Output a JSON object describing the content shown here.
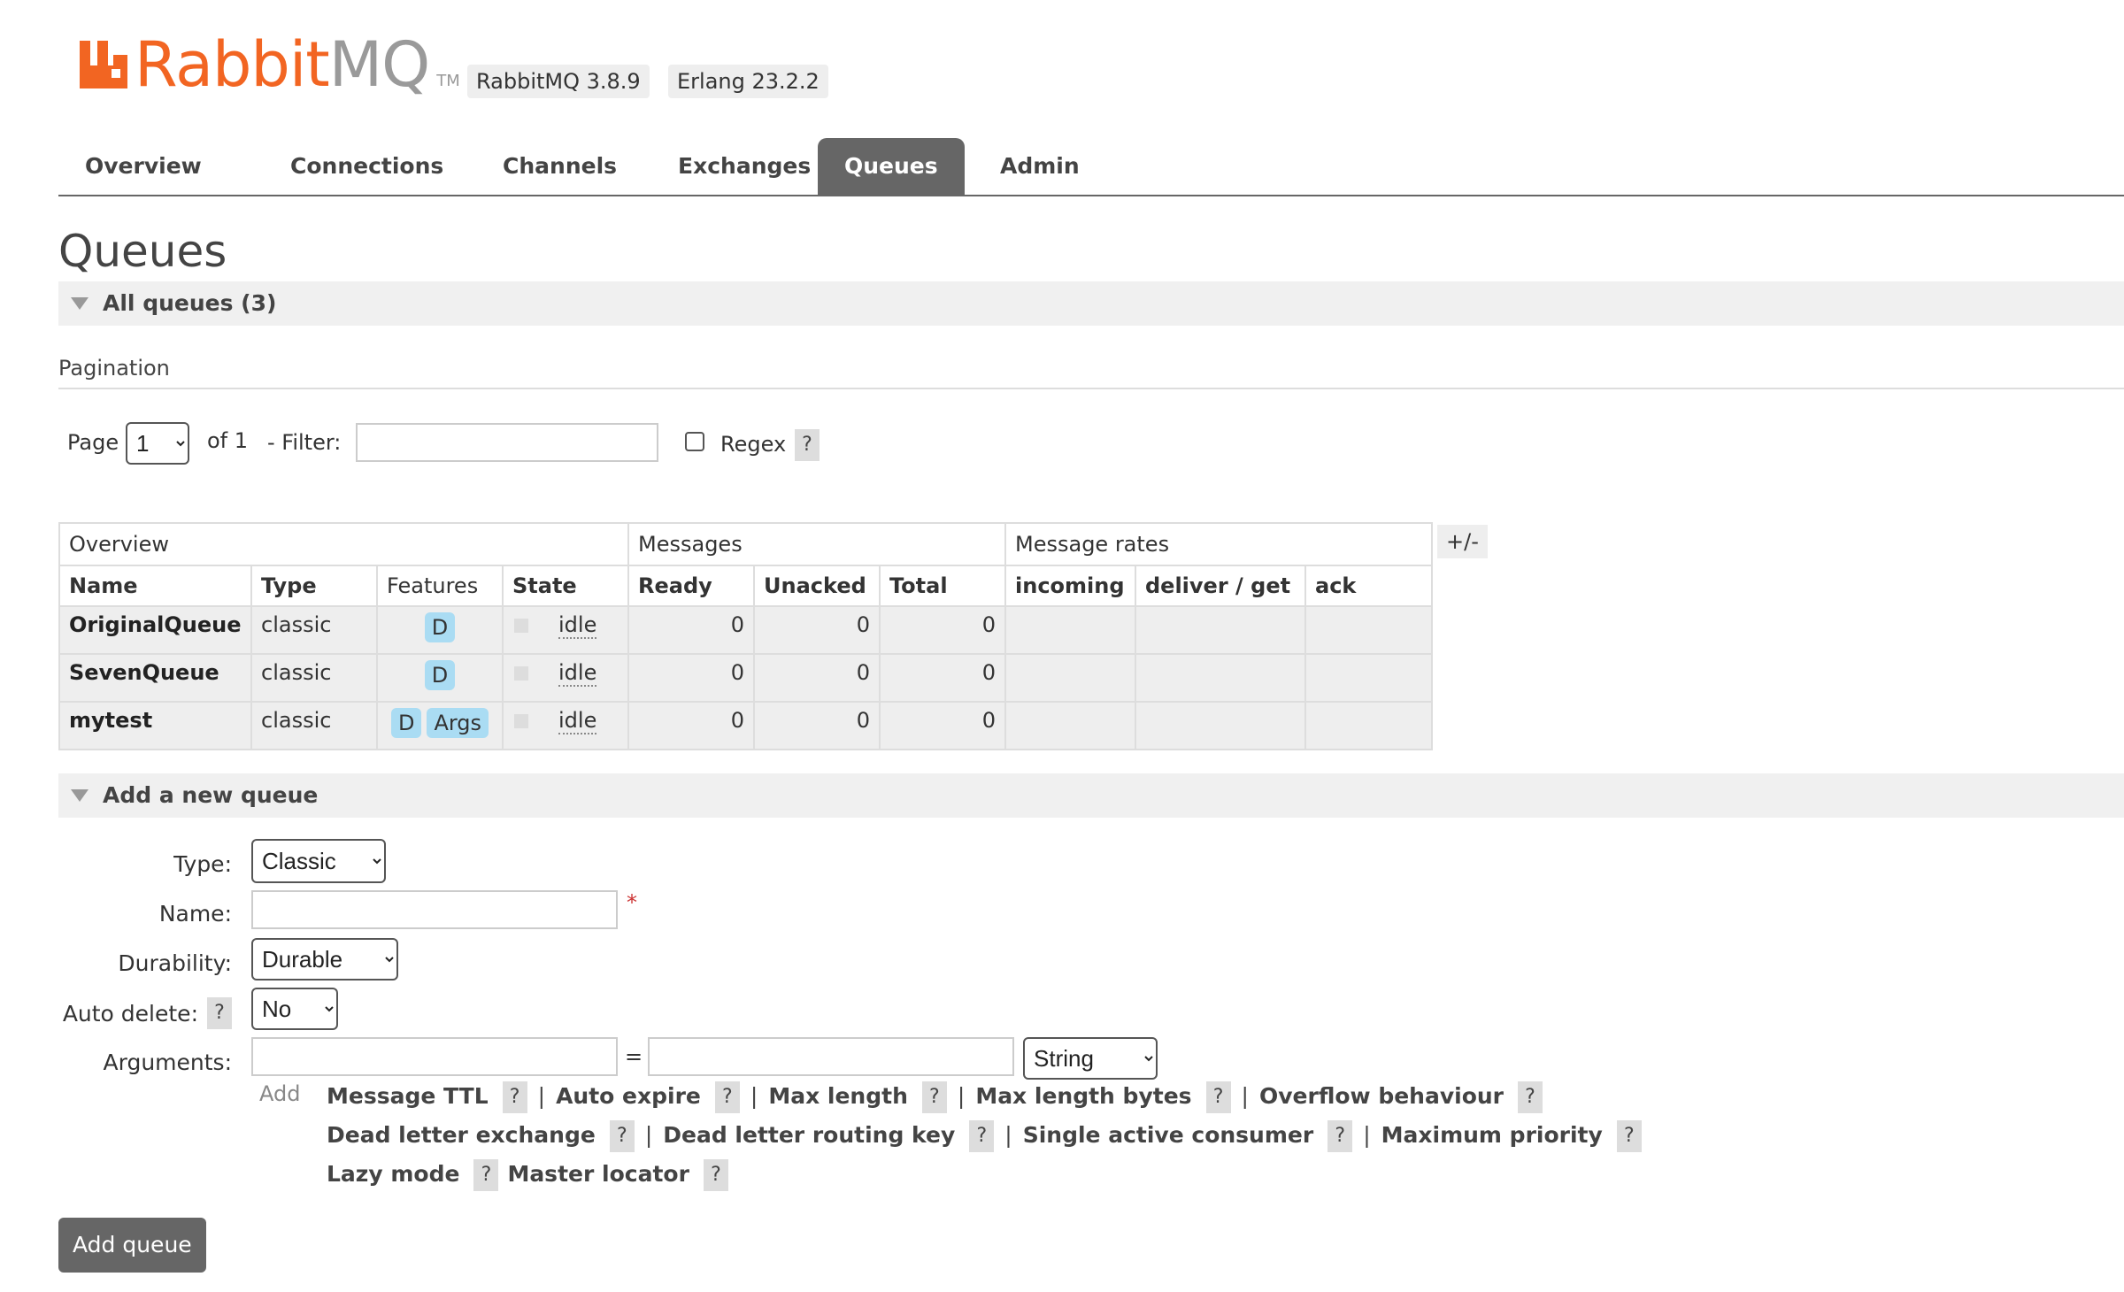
{
  "header": {
    "logo": {
      "rabbit": "Rabbit",
      "mq": "MQ",
      "tm": "TM"
    },
    "version": "RabbitMQ 3.8.9",
    "erlang": "Erlang 23.2.2"
  },
  "nav": {
    "tabs": [
      {
        "label": "Overview",
        "active": false
      },
      {
        "label": "Connections",
        "active": false
      },
      {
        "label": "Channels",
        "active": false
      },
      {
        "label": "Exchanges",
        "active": false
      },
      {
        "label": "Queues",
        "active": true
      },
      {
        "label": "Admin",
        "active": false
      }
    ]
  },
  "page": {
    "title": "Queues"
  },
  "all_queues": {
    "title": "All queues (3)",
    "pagination_label": "Pagination",
    "page_label": "Page",
    "page_value": "1",
    "of_label": "of 1",
    "filter_label": "- Filter:",
    "filter_value": "",
    "regex_label": "Regex",
    "regex_checked": false,
    "help": "?"
  },
  "table": {
    "groups": [
      "Overview",
      "Messages",
      "Message rates"
    ],
    "columns": [
      "Name",
      "Type",
      "Features",
      "State",
      "Ready",
      "Unacked",
      "Total",
      "incoming",
      "deliver / get",
      "ack"
    ],
    "toggle_label": "+/-",
    "rows": [
      {
        "name": "OriginalQueue",
        "type": "classic",
        "features": [
          "D"
        ],
        "state": "idle",
        "ready": "0",
        "unacked": "0",
        "total": "0",
        "incoming": "",
        "deliver_get": "",
        "ack": ""
      },
      {
        "name": "SevenQueue",
        "type": "classic",
        "features": [
          "D"
        ],
        "state": "idle",
        "ready": "0",
        "unacked": "0",
        "total": "0",
        "incoming": "",
        "deliver_get": "",
        "ack": ""
      },
      {
        "name": "mytest",
        "type": "classic",
        "features": [
          "D",
          "Args"
        ],
        "state": "idle",
        "ready": "0",
        "unacked": "0",
        "total": "0",
        "incoming": "",
        "deliver_get": "",
        "ack": ""
      }
    ]
  },
  "add_queue": {
    "title": "Add a new queue",
    "type_label": "Type:",
    "type_value": "Classic",
    "name_label": "Name:",
    "name_value": "",
    "required_mark": "*",
    "durability_label": "Durability:",
    "durability_value": "Durable",
    "auto_delete_label": "Auto delete:",
    "auto_delete_value": "No",
    "arguments_label": "Arguments:",
    "arg_key_value": "",
    "arg_value_value": "",
    "arg_type_value": "String",
    "equals": "=",
    "add_label": "Add",
    "argument_links": [
      [
        "Message TTL",
        "Auto expire",
        "Max length",
        "Max length bytes",
        "Overflow behaviour"
      ],
      [
        "Dead letter exchange",
        "Dead letter routing key",
        "Single active consumer",
        "Maximum priority"
      ],
      [
        "Lazy mode",
        "Master locator"
      ]
    ],
    "help": "?",
    "separator": "|",
    "submit_label": "Add queue"
  },
  "colors": {
    "brand_orange": "#f26522",
    "tab_active": "#666666",
    "feature_badge": "#aadcf3"
  }
}
